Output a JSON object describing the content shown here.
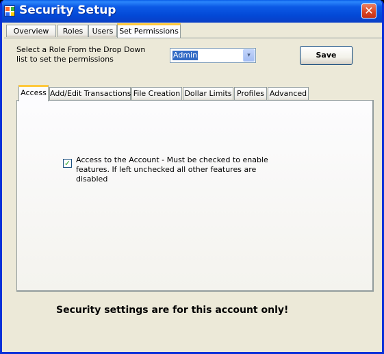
{
  "window": {
    "title": "Security Setup",
    "close_label": "✕"
  },
  "outer_tabs": [
    {
      "label": "Overview"
    },
    {
      "label": "Roles"
    },
    {
      "label": "Users"
    },
    {
      "label": "Set Permissions",
      "active": true
    }
  ],
  "role_selector": {
    "prompt": "Select a Role From the Drop Down list to set the permissions",
    "selected": "Admin",
    "dropdown_arrow": "▾"
  },
  "save_label": "Save",
  "inner_tabs": [
    {
      "label": "Access",
      "active": true
    },
    {
      "label": "Add/Edit Transactions"
    },
    {
      "label": "File Creation"
    },
    {
      "label": "Dollar Limits"
    },
    {
      "label": "Profiles"
    },
    {
      "label": "Advanced"
    }
  ],
  "access": {
    "checkbox_checked": true,
    "check_mark": "✓",
    "checkbox_label": "Access to the Account - Must be checked to enable features.  If left unchecked all other features are disabled"
  },
  "footer_note": "Security settings are for this account only!",
  "colors": {
    "titlebar": "#0a5ee8",
    "window_bg": "#ece9d8",
    "active_tab_accent": "#ffc83c",
    "selection": "#316ac5",
    "close_button": "#d8421f"
  },
  "icons": {
    "app": "windows-app-icon",
    "close": "close-icon",
    "dropdown": "chevron-down-icon",
    "check": "checkmark-icon"
  }
}
